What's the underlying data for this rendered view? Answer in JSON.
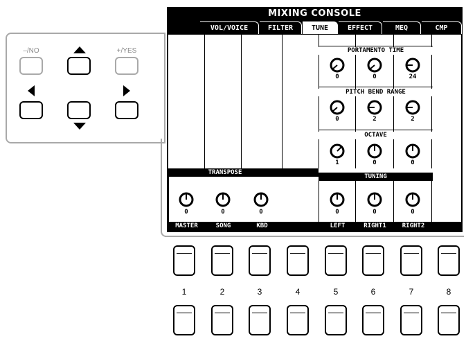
{
  "console": {
    "title": "MIXING CONSOLE",
    "tabs": [
      {
        "label": "VOL/VOICE",
        "active": false
      },
      {
        "label": "FILTER",
        "active": false
      },
      {
        "label": "TUNE",
        "active": true
      },
      {
        "label": "EFFECT",
        "active": false
      },
      {
        "label": "MEQ",
        "active": false
      },
      {
        "label": "CMP",
        "active": false
      }
    ]
  },
  "groups": {
    "transpose": "TRANSPOSE",
    "portamento": "PORTAMENTO TIME",
    "pitch_bend": "PITCH BEND RANGE",
    "octave": "OCTAVE",
    "tuning": "TUNING"
  },
  "knobs": {
    "master": "0",
    "song": "0",
    "kbd": "0",
    "portamento_left": "0",
    "portamento_right1": "0",
    "portamento_right2": "24",
    "pitch_left": "0",
    "pitch_right1": "2",
    "pitch_right2": "2",
    "octave_left": "1",
    "octave_right1": "0",
    "octave_right2": "0",
    "tuning_left": "0",
    "tuning_right1": "0",
    "tuning_right2": "0"
  },
  "columns": [
    "MASTER",
    "SONG",
    "KBD",
    "",
    "LEFT",
    "RIGHT1",
    "RIGHT2",
    ""
  ],
  "cursor_buttons": {
    "no_label": "–/NO",
    "yes_label": "+/YES"
  },
  "button_numbers": [
    "1",
    "2",
    "3",
    "4",
    "5",
    "6",
    "7",
    "8"
  ]
}
